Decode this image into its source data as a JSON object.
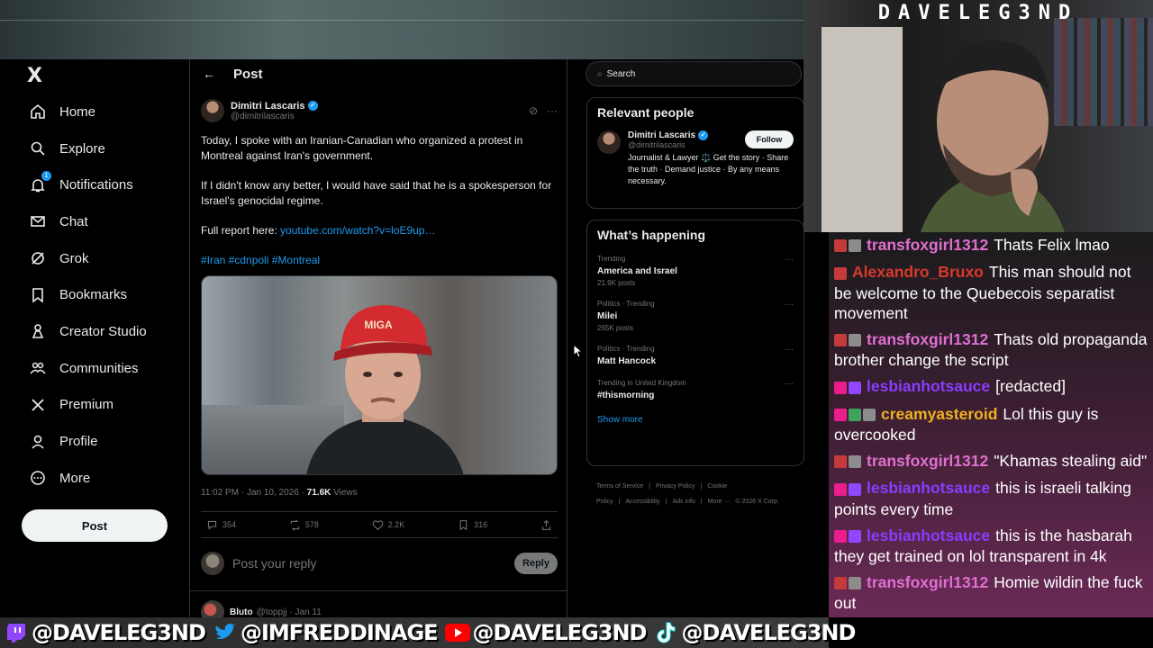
{
  "overlay": {
    "streamer_name": "DAVELEG3ND",
    "socials": [
      {
        "platform": "twitch-icon",
        "handle": "@DAVELEG3ND"
      },
      {
        "platform": "twitter-bird-icon",
        "handle": "@IMFREDDINAGE"
      },
      {
        "platform": "youtube-icon",
        "handle": "@DAVELEG3ND"
      },
      {
        "platform": "tiktok-icon",
        "handle": "@DAVELEG3ND"
      }
    ]
  },
  "nav": {
    "logo": "X",
    "items": [
      {
        "label": "Home",
        "icon": "home-icon"
      },
      {
        "label": "Explore",
        "icon": "search-icon"
      },
      {
        "label": "Notifications",
        "icon": "bell-icon",
        "badge": "1"
      },
      {
        "label": "Chat",
        "icon": "envelope-icon"
      },
      {
        "label": "Grok",
        "icon": "grok-icon"
      },
      {
        "label": "Bookmarks",
        "icon": "bookmark-icon"
      },
      {
        "label": "Creator Studio",
        "icon": "creator-studio-icon"
      },
      {
        "label": "Communities",
        "icon": "communities-icon"
      },
      {
        "label": "Premium",
        "icon": "x-premium-icon"
      },
      {
        "label": "Profile",
        "icon": "person-icon"
      },
      {
        "label": "More",
        "icon": "more-circle-icon"
      }
    ],
    "post_button": "Post"
  },
  "post": {
    "header": "Post",
    "author_name": "Dimitri Lascaris",
    "author_handle": "@dimitrilascaris",
    "text_1": "Today, I spoke with an Iranian-Canadian who organized a protest in Montreal against Iran's government.",
    "text_2": "If I didn't know any better, I would have said that he is a spokesperson for Israel's genocidal regime.",
    "text_3_prefix": "Full report here: ",
    "text_3_link": "youtube.com/watch?v=loE9up…",
    "hashtags": "#Iran #cdnpoli #Montreal",
    "time": "11:02 PM · Jan 10, 2026 · ",
    "views_count": "71.6K",
    "views_label": " Views",
    "stats": {
      "replies": "354",
      "reposts": "578",
      "likes": "2.2K",
      "bookmarks": "316"
    },
    "reply_placeholder": "Post your reply",
    "reply_button": "Reply",
    "next_author": "Bluto",
    "next_handle": "@toppjj · Jan 11"
  },
  "sidebar": {
    "search_placeholder": "Search",
    "relevant_title": "Relevant people",
    "person_name": "Dimitri Lascaris",
    "person_handle": "@dimitrilascaris",
    "person_bio": "Journalist & Lawyer ⚖️ Get the story · Share the truth · Demand justice · By any means necessary.",
    "follow": "Follow",
    "happening_title": "What’s happening",
    "trends": [
      {
        "category": "Trending",
        "name": "America and Israel",
        "count": "21.9K posts"
      },
      {
        "category": "Politics · Trending",
        "name": "Milei",
        "count": "265K posts"
      },
      {
        "category": "Politics · Trending",
        "name": "Matt Hancock",
        "count": ""
      },
      {
        "category": "Trending in United Kingdom",
        "name": "#thismorning",
        "count": ""
      }
    ],
    "show_more": "Show more",
    "footer": [
      "Terms of Service",
      "|",
      "Privacy Policy",
      "|",
      "Cookie Policy",
      "|",
      "Accessibility",
      "|",
      "Ads info",
      "|",
      "More ···",
      "© 2026 X Corp."
    ]
  },
  "chat": [
    {
      "user": "transfoxgirl1312",
      "color": "#e070d0",
      "badges": [
        "b-red",
        "b-gray"
      ],
      "text": "Thats Felix lmao"
    },
    {
      "user": "Alexandro_Bruxo",
      "color": "#d83a2a",
      "badges": [
        "b-red"
      ],
      "text": "This man should not be welcome to the Quebecois separatist movement"
    },
    {
      "user": "transfoxgirl1312",
      "color": "#e070d0",
      "badges": [
        "b-red",
        "b-gray"
      ],
      "text": "Thats old propaganda brother change the script"
    },
    {
      "user": "lesbianhotsauce",
      "color": "#8a3cff",
      "badges": [
        "b-pink",
        "b-purple"
      ],
      "text": "[redacted]"
    },
    {
      "user": "creamyasteroid",
      "color": "#f0b020",
      "badges": [
        "b-pink",
        "b-green",
        "b-gray"
      ],
      "text": "Lol this guy is overcooked"
    },
    {
      "user": "transfoxgirl1312",
      "color": "#e070d0",
      "badges": [
        "b-red",
        "b-gray"
      ],
      "text": "\"Khamas stealing aid\""
    },
    {
      "user": "lesbianhotsauce",
      "color": "#8a3cff",
      "badges": [
        "b-pink",
        "b-purple"
      ],
      "text": "this is israeli talking points every time"
    },
    {
      "user": "lesbianhotsauce",
      "color": "#8a3cff",
      "badges": [
        "b-pink",
        "b-purple"
      ],
      "text": "this is the hasbarah they get trained on lol transparent in 4k"
    },
    {
      "user": "transfoxgirl1312",
      "color": "#e070d0",
      "badges": [
        "b-red",
        "b-gray"
      ],
      "text": "Homie wildin the fuck out"
    }
  ],
  "colors": {
    "accent": "#1d9bf0",
    "background": "#000000"
  }
}
